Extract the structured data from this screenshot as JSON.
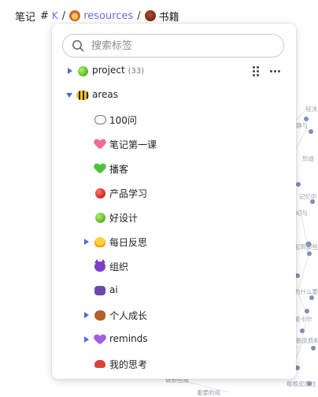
{
  "breadcrumb": {
    "root": "笔记",
    "hash": "#",
    "k_symbol": "K",
    "separator": "/",
    "resources": "resources",
    "resources_icon": "lion-face-icon",
    "current": "书籍",
    "current_icon": "chestnut-icon"
  },
  "search": {
    "placeholder": "搜索标签",
    "value": ""
  },
  "tree": [
    {
      "label": "project",
      "count": "(33)",
      "icon": "green-apple-icon",
      "caret": "right",
      "level": 0
    },
    {
      "label": "areas",
      "count": "",
      "icon": "bee-icon",
      "caret": "down",
      "level": 0
    },
    {
      "label": "100问",
      "icon": "speech-bubble-icon",
      "caret": "",
      "level": 1
    },
    {
      "label": "笔记第一课",
      "icon": "sparkling-heart-icon",
      "caret": "",
      "level": 1
    },
    {
      "label": "播客",
      "icon": "green-heart-icon",
      "caret": "",
      "level": 1
    },
    {
      "label": "产品学习",
      "icon": "red-apple-icon",
      "caret": "",
      "level": 1
    },
    {
      "label": "好设计",
      "icon": "green-apple-icon",
      "caret": "",
      "level": 1
    },
    {
      "label": "每日反思",
      "icon": "hatching-chick-icon",
      "caret": "right",
      "level": 1
    },
    {
      "label": "组织",
      "icon": "purple-devil-icon",
      "caret": "",
      "level": 1
    },
    {
      "label": "ai",
      "icon": "alien-monster-icon",
      "caret": "",
      "level": 1
    },
    {
      "label": "个人成长",
      "icon": "squirrel-icon",
      "caret": "right",
      "level": 1
    },
    {
      "label": "reminds",
      "icon": "purple-heart-icon",
      "caret": "right",
      "level": 1
    },
    {
      "label": "我的思考",
      "icon": "red-mask-icon",
      "caret": "",
      "level": 1
    }
  ],
  "graph_labels": [
    "轻决",
    "静与",
    "形成",
    "记忆中",
    "纪与",
    "起到那些",
    "为什么要",
    "斯卡尔",
    "新皮质和",
    "每根皮质柱",
    "做那些规",
    "重要的规"
  ],
  "colors": {
    "accent": "#5e63d6",
    "node": "#7f8fb5"
  }
}
